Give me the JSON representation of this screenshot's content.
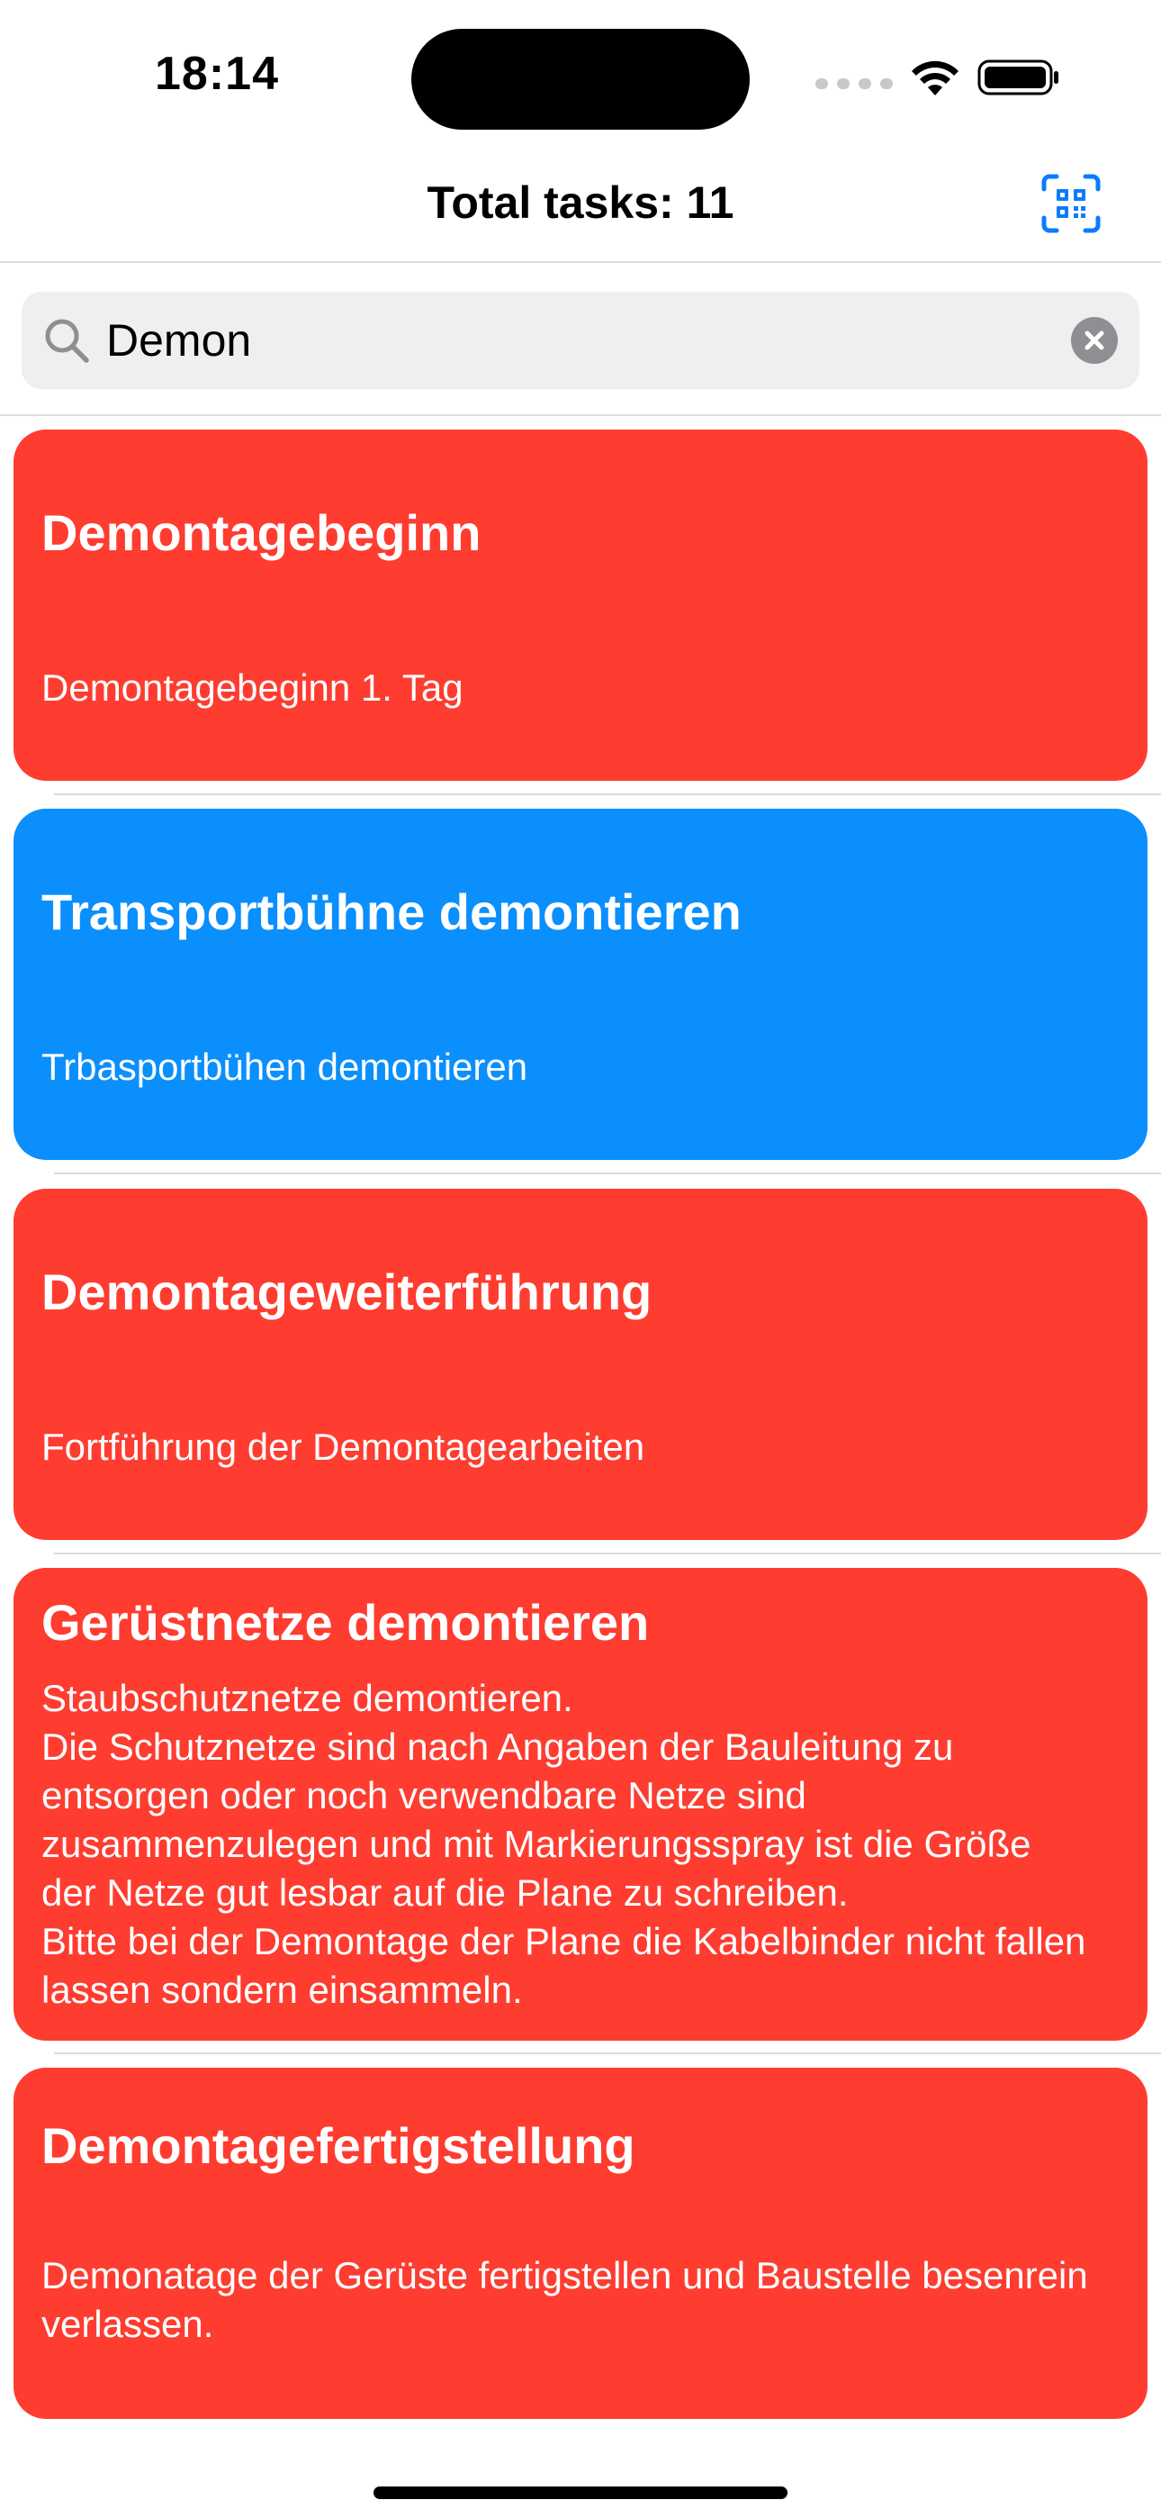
{
  "status_bar": {
    "time": "18:14"
  },
  "nav": {
    "title": "Total tasks: 11",
    "scan_icon": "qr-code-scan-icon"
  },
  "search": {
    "value": "Demon",
    "placeholder": "Search"
  },
  "colors": {
    "red": "#fe3c30",
    "blue": "#0a8ffd",
    "accent": "#0a7cff"
  },
  "tasks": [
    {
      "title": "Demontagebeginn",
      "description": "Demontagebeginn 1. Tag",
      "color": "red"
    },
    {
      "title": "Transportbühne demontieren",
      "description": "Trbasportbühen demontieren",
      "color": "blue"
    },
    {
      "title": "Demontageweiterführung",
      "description": "Fortführung der Demontagearbeiten",
      "color": "red"
    },
    {
      "title": "Gerüstnetze demontieren",
      "description": "Staubschutznetze demontieren.\nDie Schutznetze sind nach Angaben der Bauleitung zu entsorgen oder noch verwendbare Netze sind zusammenzulegen und mit Markierungsspray ist die Größe der Netze gut lesbar auf die Plane zu schreiben.\nBitte bei der Demontage der Plane die Kabelbinder nicht fallen lassen sondern einsammeln.",
      "color": "red"
    },
    {
      "title": "Demontagefertigstellung",
      "description": "Demonatage der Gerüste fertigstellen und Baustelle besenrein verlassen.",
      "color": "red"
    }
  ]
}
